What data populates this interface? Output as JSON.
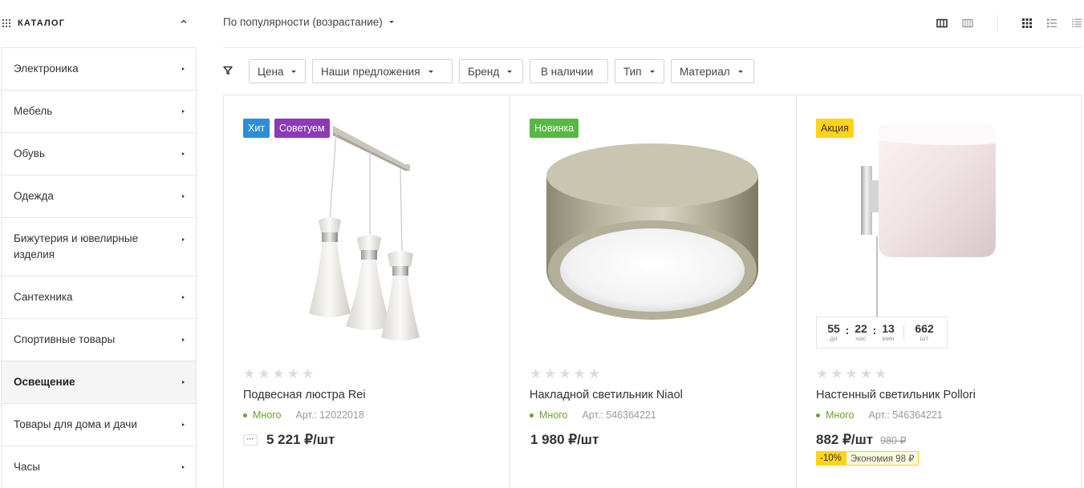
{
  "sidebar": {
    "title": "КАТАЛОГ",
    "items": [
      {
        "label": "Электроника"
      },
      {
        "label": "Мебель"
      },
      {
        "label": "Обувь"
      },
      {
        "label": "Одежда"
      },
      {
        "label": "Бижутерия и ювелирные изделия"
      },
      {
        "label": "Сантехника"
      },
      {
        "label": "Спортивные товары"
      },
      {
        "label": "Освещение",
        "active": true
      },
      {
        "label": "Товары для дома и дачи"
      },
      {
        "label": "Часы"
      }
    ]
  },
  "toolbar": {
    "sort_label": "По популярности (возрастание)",
    "view_icons": [
      "grid-3-icon",
      "grid-4-icon",
      "tiles-icon",
      "list-icon",
      "table-icon"
    ]
  },
  "filters": [
    {
      "label": "Цена",
      "dropdown": true
    },
    {
      "label": "Наши предложения",
      "dropdown": true
    },
    {
      "label": "Бренд",
      "dropdown": true
    },
    {
      "label": "В наличии",
      "dropdown": false
    },
    {
      "label": "Тип",
      "dropdown": true
    },
    {
      "label": "Материал",
      "dropdown": true
    }
  ],
  "products": [
    {
      "badges": [
        {
          "label": "Хит",
          "color": "#2d8ed8"
        },
        {
          "label": "Советуем",
          "color": "#8c3ab8"
        }
      ],
      "name": "Подвесная люстра Rei",
      "stock": "Много",
      "article": "Арт.: 12022018",
      "price": "5 221 ₽/шт",
      "more_label": "···"
    },
    {
      "badges": [
        {
          "label": "Новинка",
          "color": "#58b845"
        }
      ],
      "name": "Накладной светильник Niaol",
      "stock": "Много",
      "article": "Арт.: 546364221",
      "price": "1 980 ₽/шт"
    },
    {
      "badges": [
        {
          "label": "Акция",
          "color": "#ffd31a"
        }
      ],
      "name": "Настенный светильник Pollori",
      "stock": "Много",
      "article": "Арт.: 546364221",
      "price": "882 ₽/шт",
      "old_price": "980 ₽",
      "discount_pct": "-10%",
      "discount_save": "Экономия 98 ₽",
      "timer": {
        "days": "55",
        "days_unit": "дн",
        "hours": "22",
        "hours_unit": "час",
        "mins": "13",
        "mins_unit": "мин",
        "qty": "662",
        "qty_unit": "шт"
      }
    }
  ],
  "colors": {
    "accent_green": "#6aa32f",
    "star_gray": "#dcdcdc",
    "sale_yellow": "#ffd31a"
  }
}
